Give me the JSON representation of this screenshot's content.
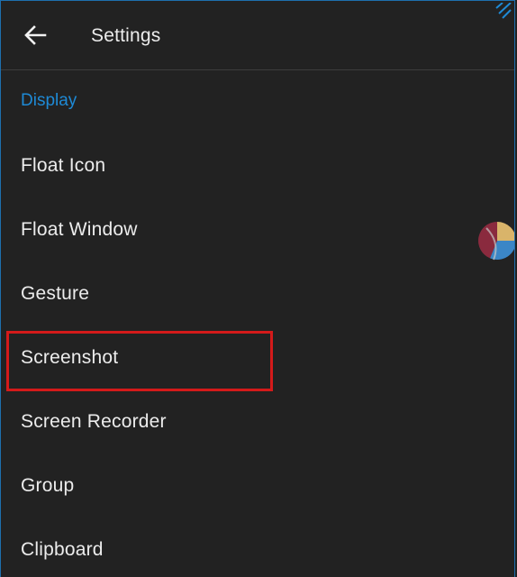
{
  "appbar": {
    "title": "Settings",
    "back_icon": "arrow-left-icon"
  },
  "section": {
    "header": "Display"
  },
  "items": [
    {
      "label": "Float Icon"
    },
    {
      "label": "Float Window"
    },
    {
      "label": "Gesture"
    },
    {
      "label": "Screenshot",
      "highlighted": true
    },
    {
      "label": "Screen Recorder"
    },
    {
      "label": "Group"
    },
    {
      "label": "Clipboard"
    }
  ],
  "colors": {
    "background": "#222222",
    "accent": "#1e8ad6",
    "text": "#ececec",
    "highlight": "#d41a1a"
  }
}
